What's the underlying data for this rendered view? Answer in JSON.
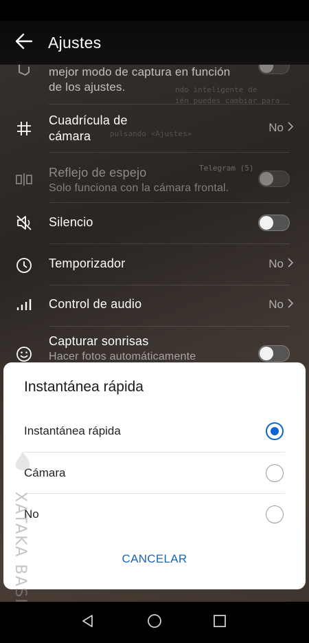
{
  "app": {
    "title": "Ajustes"
  },
  "settings": {
    "partial_top": {
      "sub_line1": "mejor modo de captura en función",
      "sub_line2": "de los ajustes."
    },
    "grid": {
      "title_line1": "Cuadrícula de",
      "title_line2": "cámara",
      "value": "No"
    },
    "mirror": {
      "title": "Reflejo de espejo",
      "subtitle": "Solo funciona con la cámara frontal."
    },
    "mute": {
      "title": "Silencio"
    },
    "timer": {
      "title": "Temporizador",
      "value": "No"
    },
    "audio": {
      "title": "Control de audio",
      "value": "No"
    },
    "smile": {
      "title": "Capturar sonrisas",
      "subtitle": "Hacer fotos automáticamente"
    }
  },
  "dialog": {
    "title": "Instantánea rápida",
    "options": [
      {
        "label": "Instantánea rápida",
        "selected": true
      },
      {
        "label": "Cámara",
        "selected": false
      },
      {
        "label": "No",
        "selected": false
      }
    ],
    "cancel_label": "CANCELAR"
  },
  "watermark": {
    "text": "XATAKA BASICS"
  },
  "colors": {
    "accent": "#0a66d6",
    "cancel": "#1565c0",
    "dialog_bg": "#ffffff"
  },
  "icons": {
    "back": "arrow-left-icon",
    "grid": "hash-grid-icon",
    "mirror": "mirror-icon",
    "mute": "speaker-muted-icon",
    "timer": "timer-icon",
    "audio": "audio-bars-icon",
    "smile": "smiley-icon",
    "nav_back": "triangle-back-icon",
    "nav_home": "circle-home-icon",
    "nav_recent": "square-recent-icon"
  }
}
